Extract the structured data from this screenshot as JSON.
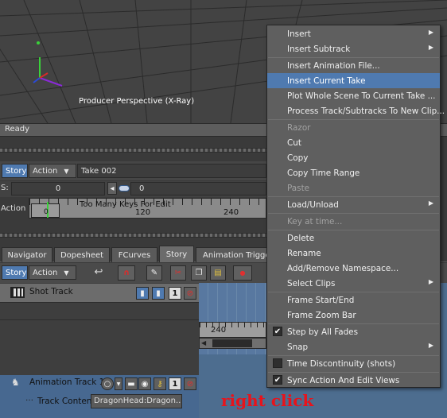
{
  "viewport": {
    "label": "Producer Perspective (X-Ray)"
  },
  "status": {
    "text": "Ready"
  },
  "story_row": {
    "story": "Story",
    "action": "Action",
    "take": "Take 002"
  },
  "time_row": {
    "s_label": "S:",
    "s_value": "0",
    "value2": "0"
  },
  "action_row": {
    "label": "Action",
    "marker": "0",
    "keys_msg": "Too Many Keys For Edit",
    "tick1": "120",
    "tick2": "240"
  },
  "tabs": [
    "Navigator",
    "Dopesheet",
    "FCurves",
    "Story",
    "Animation Trigger"
  ],
  "active_tab": "Story",
  "toolbar": {
    "story": "Story",
    "action": "Action"
  },
  "shot_track": {
    "label": "Shot Track",
    "num": "1"
  },
  "timeline": {
    "tick": "240"
  },
  "anim_track": {
    "label": "Animation Track 1",
    "content_label": "Track Content",
    "content_value": "DragonHead:Dragon...",
    "num": "1"
  },
  "menu": {
    "insert": "Insert",
    "insert_subtrack": "Insert Subtrack",
    "insert_anim_file": "Insert Animation File...",
    "insert_current_take": "Insert Current Take",
    "plot_whole_scene": "Plot Whole Scene To Current Take ...",
    "process_track": "Process Track/Subtracks To New Clip...",
    "razor": "Razor",
    "cut": "Cut",
    "copy": "Copy",
    "copy_time_range": "Copy Time Range",
    "paste": "Paste",
    "load_unload": "Load/Unload",
    "key_at_time": "Key at time...",
    "delete": "Delete",
    "rename": "Rename",
    "add_remove_namespace": "Add/Remove Namespace...",
    "select_clips": "Select Clips",
    "frame_start_end": "Frame Start/End",
    "frame_zoom_bar": "Frame Zoom Bar",
    "step_by_all_fades": "Step by All Fades",
    "snap": "Snap",
    "time_discontinuity": "Time Discontinuity (shots)",
    "sync_action_edit": "Sync Action And Edit Views"
  },
  "annotation": {
    "text": "right click"
  },
  "colors": {
    "highlight": "#4f7ab0",
    "annotation": "#e8131b"
  }
}
